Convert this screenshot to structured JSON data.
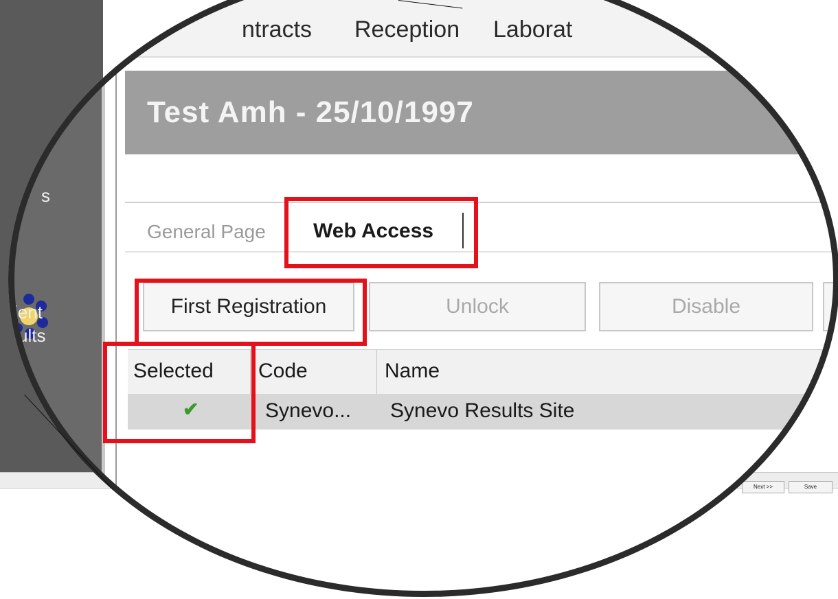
{
  "menu": {
    "items": [
      "ntracts",
      "Reception",
      "Laborat"
    ]
  },
  "sidebar": {
    "text_top": "s",
    "label_line1": "ient",
    "label_line2": "ults",
    "icon": "flower-icon"
  },
  "header": {
    "title": "Test Amh  - 25/10/1997"
  },
  "tabs": {
    "general": "General Page",
    "web_access": "Web Access"
  },
  "toolbar": {
    "first_registration": "First Registration",
    "unlock": "Unlock",
    "disable": "Disable"
  },
  "grid": {
    "columns": [
      "Selected",
      "Code",
      "Name"
    ],
    "rows": [
      {
        "selected": "✔",
        "code": "Synevo...",
        "name": "Synevo Results Site"
      }
    ]
  },
  "footer": {
    "next_label": "Next >>",
    "save_label": "Save"
  },
  "colors": {
    "highlight": "#e4101a",
    "check": "#3a9a2a",
    "header_bg": "#9e9e9e"
  }
}
